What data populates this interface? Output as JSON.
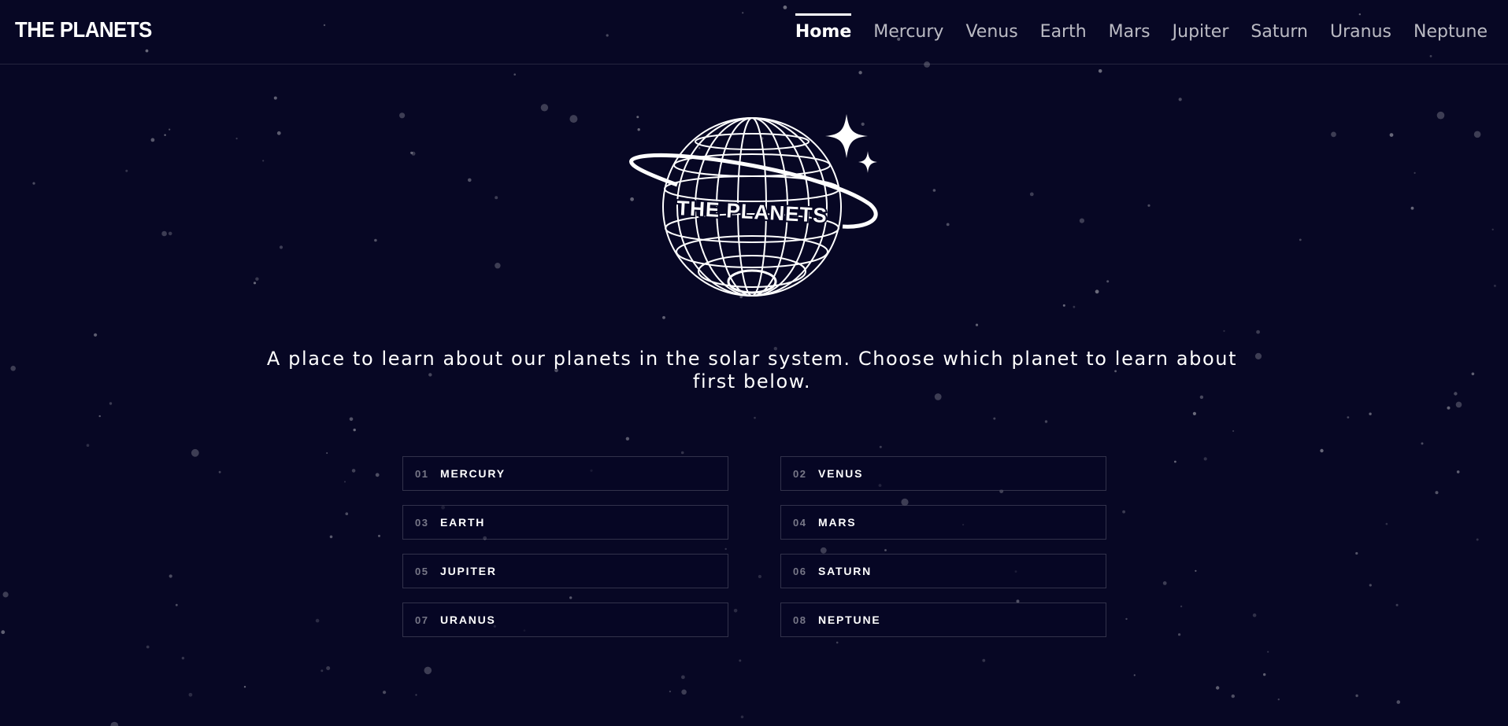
{
  "header": {
    "logo_text": "THE PLANETS",
    "nav": [
      {
        "label": "Home",
        "active": true
      },
      {
        "label": "Mercury",
        "active": false
      },
      {
        "label": "Venus",
        "active": false
      },
      {
        "label": "Earth",
        "active": false
      },
      {
        "label": "Mars",
        "active": false
      },
      {
        "label": "Jupiter",
        "active": false
      },
      {
        "label": "Saturn",
        "active": false
      },
      {
        "label": "Uranus",
        "active": false
      },
      {
        "label": "Neptune",
        "active": false
      }
    ]
  },
  "hero": {
    "logo_text": "THE PLANETS",
    "tagline": "A place to learn about our planets in the solar system. Choose which planet to learn about first below."
  },
  "planets": [
    {
      "num": "01",
      "name": "MERCURY"
    },
    {
      "num": "02",
      "name": "VENUS"
    },
    {
      "num": "03",
      "name": "EARTH"
    },
    {
      "num": "04",
      "name": "MARS"
    },
    {
      "num": "05",
      "name": "JUPITER"
    },
    {
      "num": "06",
      "name": "SATURN"
    },
    {
      "num": "07",
      "name": "URANUS"
    },
    {
      "num": "08",
      "name": "NEPTUNE"
    }
  ],
  "colors": {
    "background": "#070724",
    "text": "#ffffff",
    "muted_text": "#ffffffb8",
    "border": "#ffffff2e"
  }
}
